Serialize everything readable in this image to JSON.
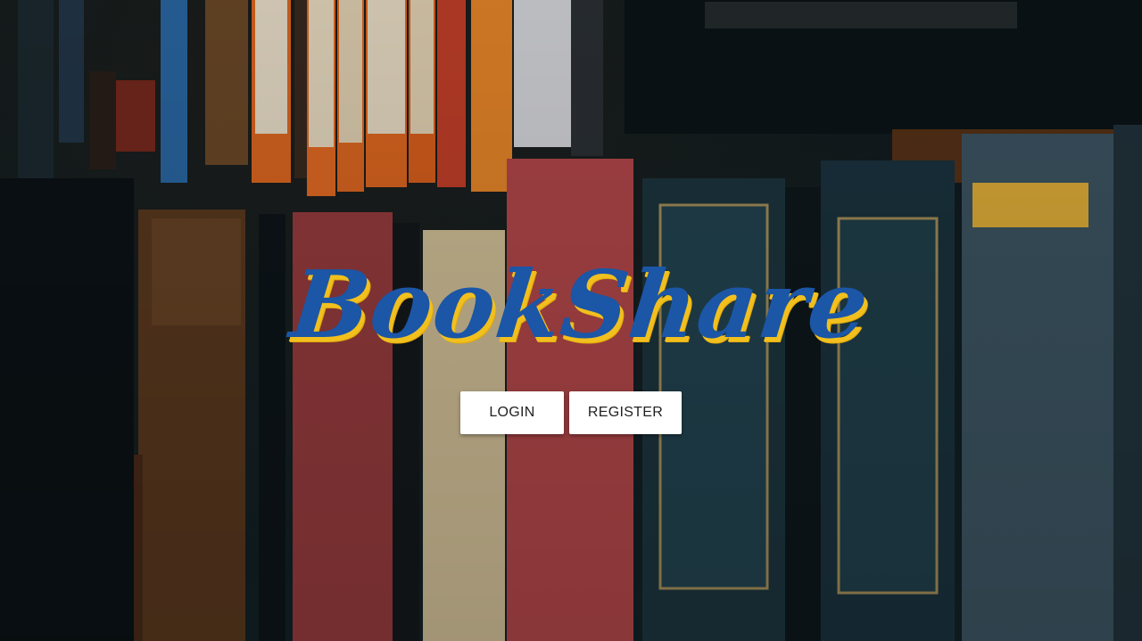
{
  "brand": {
    "title": "BookShare",
    "primary_color": "#1b56a7",
    "shadow_color": "#f2c01e"
  },
  "actions": {
    "login_label": "LOGIN",
    "register_label": "REGISTER"
  },
  "background": {
    "description_icon": "bookshelf-photo"
  }
}
